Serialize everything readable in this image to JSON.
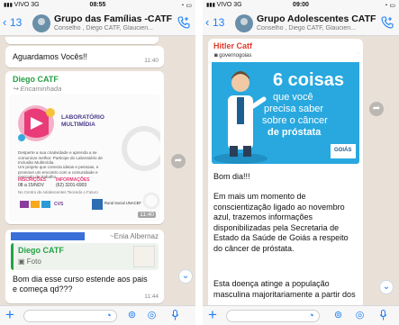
{
  "left": {
    "status": {
      "carrier": "VIVO 3G",
      "time": "08:55"
    },
    "header": {
      "back_count": "13",
      "title": "Grupo das Famílias -CATF",
      "subtitle": "Conselho , Diego CATF, Glaucien..."
    },
    "messages": {
      "aguardamos": {
        "text": "Aguardamos Vocês!!",
        "time": "11:40"
      },
      "forward": {
        "sender": "Diego CATF",
        "forwarded_label": "Encaminhada",
        "time": "11:40",
        "poster": {
          "title": "LABORATÓRIO\nMULTIMÍDIA",
          "body": "Desperte a sua criatividade e aprenda a se comunicar melhor. Participe do Laboratório de Inclusão Multimídia.",
          "subtext": "Um projeto que conecta ideias e pessoas, e promove um encontro com a comunidade e mercado de trabalho.",
          "inscricoes_label": "INSCRIÇÕES",
          "inscricoes_value": "08 a 15/NOV",
          "informacoes_label": "INFORMAÇÕES",
          "informacoes_value": "(62) 3201-6903",
          "location": "No Centro de Adolescentes Tecendo o Futuro",
          "partners": [
            "CVS",
            "Rural Social UNACEF"
          ]
        }
      },
      "reply": {
        "author": "~Enia Albernaz",
        "quoted_sender": "Diego CATF",
        "quoted_type": "Foto",
        "text": "Bom dia esse curso estende aos pais e começa qd???",
        "time": "11:44"
      }
    }
  },
  "right": {
    "status": {
      "carrier": "VIVO 3G",
      "time": "09:00"
    },
    "header": {
      "back_count": "13",
      "title": "Grupo Adolescentes CATF",
      "subtitle": "Conselho , Diego CATF, Glaucien..."
    },
    "messages": {
      "post": {
        "sender": "Hitler Catf",
        "account": "governogoias",
        "headline": {
          "number": "6 coisas",
          "line2": "que você",
          "line3": "precisa saber",
          "line4": "sobre o câncer",
          "line5": "de próstata"
        },
        "brand": "GOIÁS",
        "body": [
          "Bom dia!!!",
          "Em mais um momento de conscientização ligado ao novembro azul, trazemos informações disponibilizadas pela Secretaria de Estado da Saúde de Goiás a respeito do câncer de próstata.",
          "Esta doença atinge a população masculina majoritariamente a partir dos"
        ]
      }
    }
  },
  "icons": {
    "back": "chevron-left-icon",
    "call": "add-call-icon",
    "plus": "plus-icon",
    "sticker": "sticker-icon",
    "camera": "camera-icon",
    "mic": "microphone-icon",
    "share": "share-forward-icon",
    "scroll": "chevron-down-icon"
  },
  "colors": {
    "accent": "#1a7ef7",
    "sender_green": "#25a244",
    "sender_red": "#e03b2e",
    "chat_bg": "#e9e1d8",
    "poster_blue": "#29a8df"
  }
}
